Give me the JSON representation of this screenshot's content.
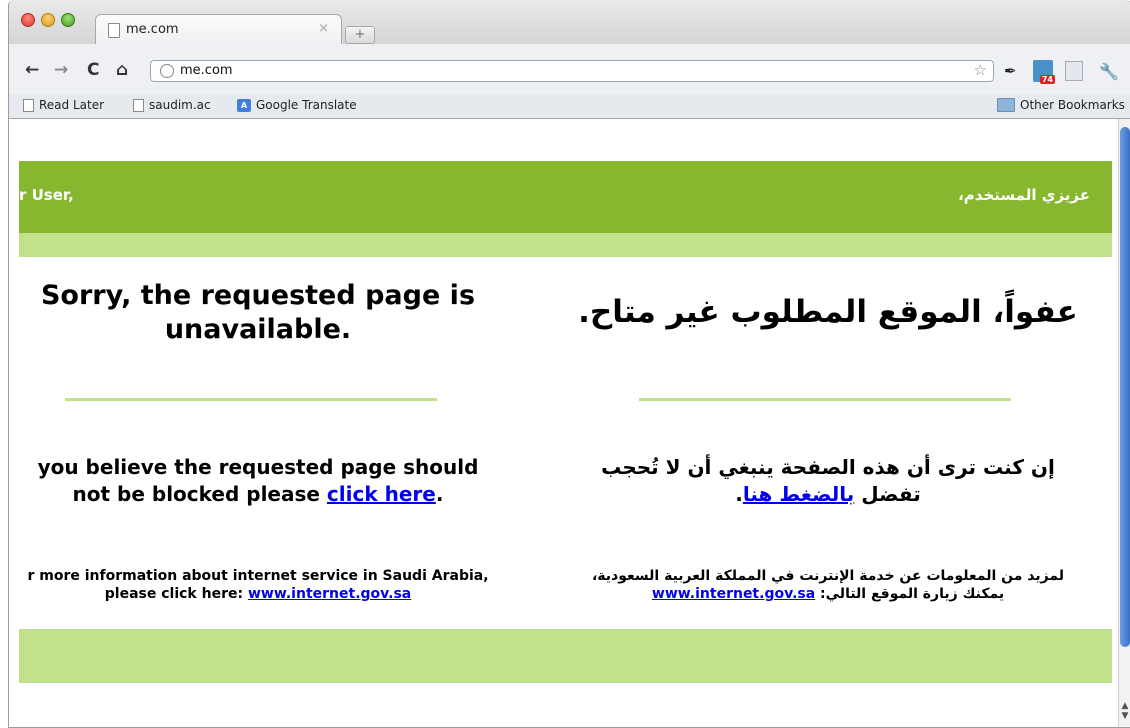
{
  "tab": {
    "title": "me.com",
    "close": "×",
    "new_tab": "+"
  },
  "toolbar": {
    "back": "←",
    "forward": "→",
    "reload": "C",
    "home": "⌂",
    "url": "me.com",
    "star": "☆",
    "extensions": [
      "pin-icon",
      "calendar-icon",
      "page-icon",
      "wrench-icon"
    ],
    "calendar_badge": "74",
    "wrench": "🔧"
  },
  "bookmarks": {
    "items": [
      {
        "label": "Read Later"
      },
      {
        "label": "saudim.ac"
      },
      {
        "label": "Google Translate",
        "icon_text": "A"
      }
    ],
    "other": "Other Bookmarks"
  },
  "page": {
    "header_en": "r User,",
    "header_ar": "عزيزي المستخدم،",
    "title_en_1": "Sorry, the requested page is",
    "title_en_2": "unavailable.",
    "title_ar": "عفواً، الموقع المطلوب غير متاح.",
    "block_en_1": "you believe the requested page should",
    "block_en_2": "not be blocked please",
    "block_en_link": "click here",
    "block_en_end": ".",
    "block_ar_1": "إن كنت ترى أن هذه الصفحة ينبغي أن لا تُحجب",
    "block_ar_2": "تفضل",
    "block_ar_link": "بالضغط هنا",
    "block_ar_end": ".",
    "info_en_1": "r more information about internet service in Saudi Arabia,",
    "info_en_2": "please click here:",
    "info_en_link": "www.internet.gov.sa",
    "info_ar_1": "لمزيد من المعلومات عن خدمة الإنترنت في المملكة العربية السعودية،",
    "info_ar_2": "يمكنك زيارة الموقع التالي:",
    "info_ar_link": "www.internet.gov.sa"
  },
  "colors": {
    "header_green": "#86b72e",
    "light_green": "#c1e28b",
    "link": "#0000ee"
  }
}
